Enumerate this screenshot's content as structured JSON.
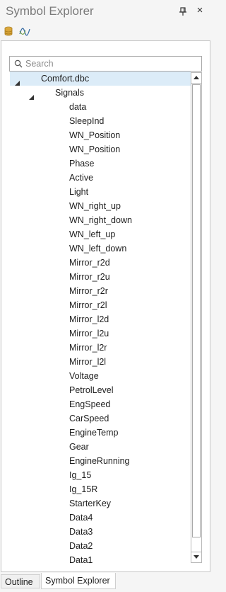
{
  "window": {
    "title": "Symbol Explorer",
    "pin_icon": "pin-icon",
    "close_label": "×"
  },
  "toolbar": {
    "items": [
      "database-icon",
      "signal-wave-icon"
    ]
  },
  "search": {
    "placeholder": "Search",
    "value": ""
  },
  "tree": {
    "root": "Comfort.dbc",
    "group": "Signals",
    "signals": [
      "data",
      "SleepInd",
      "WN_Position",
      "WN_Position",
      "Phase",
      "Active",
      "Light",
      "WN_right_up",
      "WN_right_down",
      "WN_left_up",
      "WN_left_down",
      "Mirror_r2d",
      "Mirror_r2u",
      "Mirror_r2r",
      "Mirror_r2l",
      "Mirror_l2d",
      "Mirror_l2u",
      "Mirror_l2r",
      "Mirror_l2l",
      "Voltage",
      "PetrolLevel",
      "EngSpeed",
      "CarSpeed",
      "EngineTemp",
      "Gear",
      "EngineRunning",
      "Ig_15",
      "Ig_15R",
      "StarterKey",
      "Data4",
      "Data3",
      "Data2",
      "Data1"
    ]
  },
  "bottom_tabs": [
    "Outline",
    "Symbol Explorer"
  ],
  "colors": {
    "selection": "#dcecf8",
    "db_icon": "#d9a63a",
    "wave_icon": "#3a6ea5"
  }
}
